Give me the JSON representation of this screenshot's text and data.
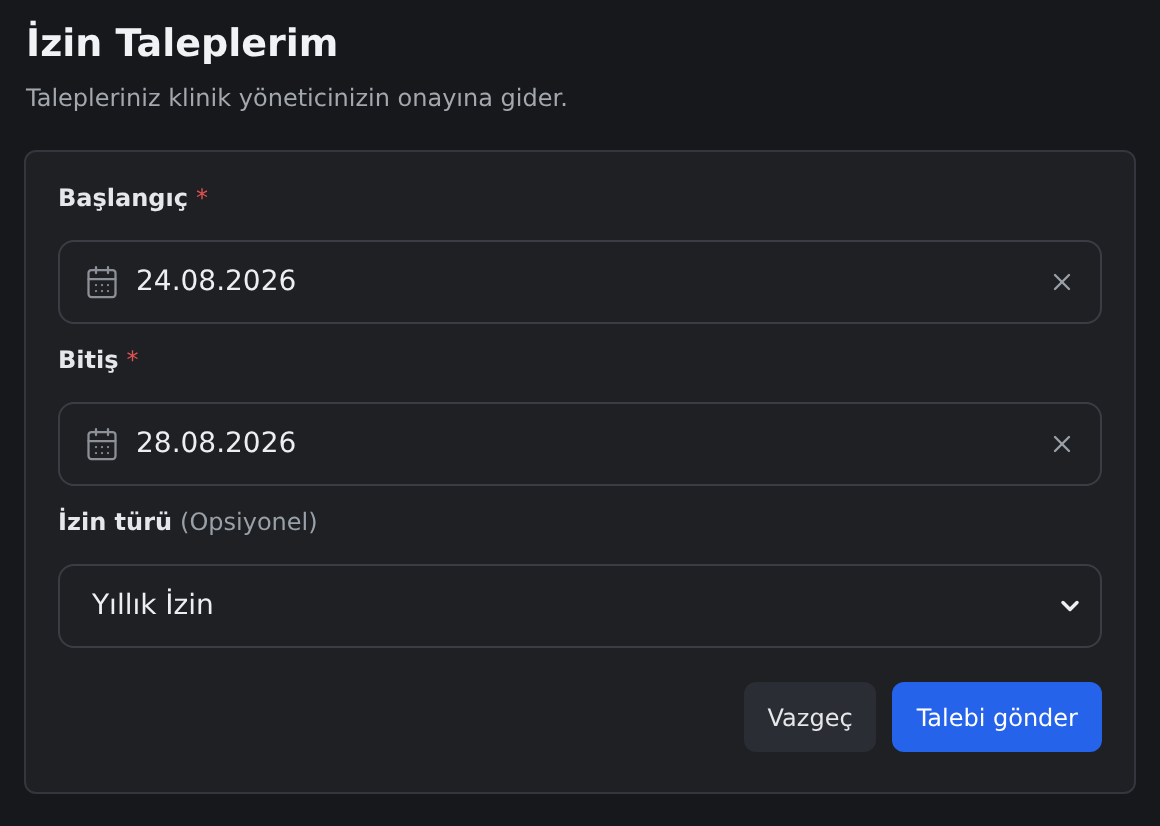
{
  "page": {
    "title": "İzin Taleplerim",
    "subtitle": "Talepleriniz klinik yöneticinizin onayına gider."
  },
  "fields": [
    {
      "kind": "date",
      "label": "Başlangıç",
      "required_mark": "*",
      "value": "24.08.2026"
    },
    {
      "kind": "date",
      "label": "Bitiş",
      "required_mark": "*",
      "value": "28.08.2026"
    },
    {
      "kind": "select",
      "label": "İzin türü",
      "note": "(Opsiyonel)",
      "value": "Yıllık İzin"
    }
  ],
  "buttons": [
    {
      "label": "Vazgeç",
      "kind": "secondary"
    },
    {
      "label": "Talebi gönder",
      "kind": "primary"
    }
  ]
}
